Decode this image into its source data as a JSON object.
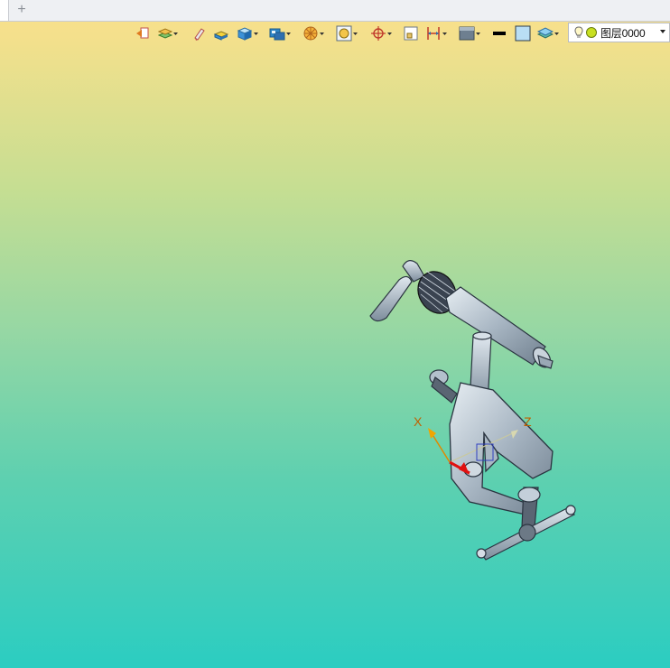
{
  "tabs": {
    "new_tab_label": "+"
  },
  "toolbar": {
    "icons": [
      "exit-sketch-icon",
      "layers-icon",
      "eraser-icon",
      "solid-color-icon",
      "box-view-icon",
      "render-mode-icon",
      "section-view-icon",
      "zoom-fit-icon",
      "snap-target-icon",
      "frame-icon",
      "dimension-icon",
      "display-style-icon",
      "line-color-icon",
      "fill-color-icon",
      "stack-layers-icon"
    ],
    "layer": {
      "name": "图层0000",
      "visible_icon": "bulb-icon",
      "color": "#c8e021"
    }
  },
  "viewport": {
    "axis_labels": {
      "x": "X",
      "z": "Z"
    },
    "background_top": "#fce18a",
    "background_bottom": "#2bcdc1"
  }
}
